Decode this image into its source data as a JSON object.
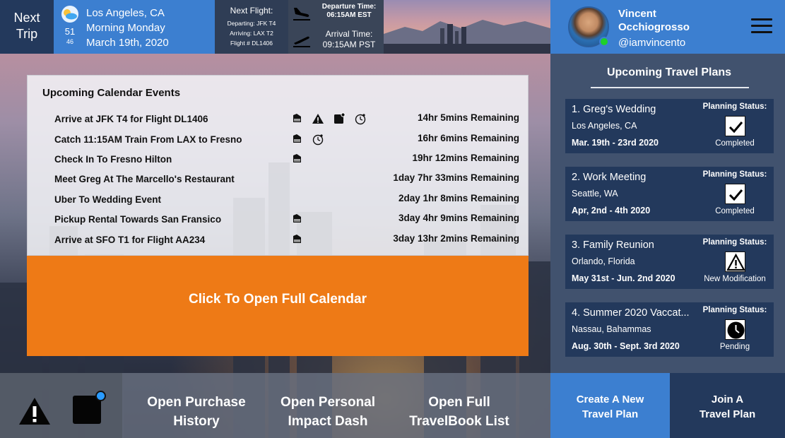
{
  "header": {
    "next_trip": [
      "Next",
      "Trip"
    ],
    "weather": {
      "icon": "partly-cloudy-icon",
      "temp_high": "51",
      "temp_low": "46",
      "city": "Los Angeles, CA",
      "day": "Morning Monday",
      "date": "March 19th, 2020"
    },
    "flight": {
      "title": "Next Flight:",
      "departing": "Departing: JFK T4",
      "arriving": "Arriving: LAX T2",
      "flight_no": "Flight # DL1406"
    },
    "times": {
      "departure_label": "Departure Time:",
      "departure_value": "06:15AM EST",
      "arrival_label": "Arrival Time:",
      "arrival_value": "09:15AM PST"
    },
    "profile": {
      "first_name": "Vincent",
      "last_name": "Occhiogrosso",
      "handle": "@iamvincento",
      "status_color": "#1ed12a"
    }
  },
  "calendar": {
    "title": "Upcoming Calendar Events",
    "events": [
      {
        "name": "Arrive at JFK T4 for Flight DL1406",
        "remaining": "14hr 5mins Remaining",
        "icons": [
          "luggage-icon",
          "warning-icon",
          "note-badge-icon",
          "clock-icon"
        ]
      },
      {
        "name": "Catch 11:15AM Train From LAX to Fresno",
        "remaining": "16hr 6mins Remaining",
        "icons": [
          "luggage-icon",
          "clock-icon"
        ]
      },
      {
        "name": "Check In To Fresno Hilton",
        "remaining": "19hr 12mins Remaining",
        "icons": [
          "luggage-icon"
        ]
      },
      {
        "name": "Meet Greg At The Marcello's Restaurant",
        "remaining": "1day 7hr 33mins Remaining",
        "icons": []
      },
      {
        "name": "Uber To Wedding Event",
        "remaining": "2day 1hr 8mins Remaining",
        "icons": []
      },
      {
        "name": "Pickup Rental Towards San Fransico",
        "remaining": "3day 4hr 9mins Remaining",
        "icons": [
          "luggage-icon"
        ]
      },
      {
        "name": "Arrive at SFO T1 for Flight AA234",
        "remaining": "3day 13hr 2mins Remaining",
        "icons": [
          "luggage-icon"
        ]
      }
    ],
    "open_label": "Click To Open Full Calendar"
  },
  "plans": {
    "title": "Upcoming Travel Plans",
    "status_label": "Planning Status:",
    "items": [
      {
        "title": "1. Greg's Wedding",
        "location": "Los Angeles, CA",
        "dates": "Mar. 19th - 23rd 2020",
        "status": "Completed",
        "status_icon": "checkmark-icon"
      },
      {
        "title": "2. Work Meeting",
        "location": "Seattle, WA",
        "dates": "Apr, 2nd - 4th 2020",
        "status": "Completed",
        "status_icon": "checkmark-icon"
      },
      {
        "title": "3. Family Reunion",
        "location": "Orlando, Florida",
        "dates": "May 31st - Jun. 2nd 2020",
        "status": "New Modification",
        "status_icon": "warning-icon"
      },
      {
        "title": "4. Summer 2020 Vaccat...",
        "location": "Nassau, Bahammas",
        "dates": "Aug. 30th - Sept. 3rd 2020",
        "status": "Pending",
        "status_icon": "clock-icon"
      }
    ]
  },
  "bottom": {
    "purchase": [
      "Open Purchase",
      "History"
    ],
    "impact": [
      "Open Personal",
      "Impact Dash"
    ],
    "travelbook": [
      "Open Full",
      "TravelBook List"
    ],
    "create": [
      "Create A New",
      "Travel Plan"
    ],
    "join": [
      "Join A",
      "Travel Plan"
    ]
  },
  "colors": {
    "accent_blue": "#3c7fd0",
    "navy": "#23395c",
    "orange": "#ee7a16",
    "notification_blue": "#2a9bff"
  }
}
